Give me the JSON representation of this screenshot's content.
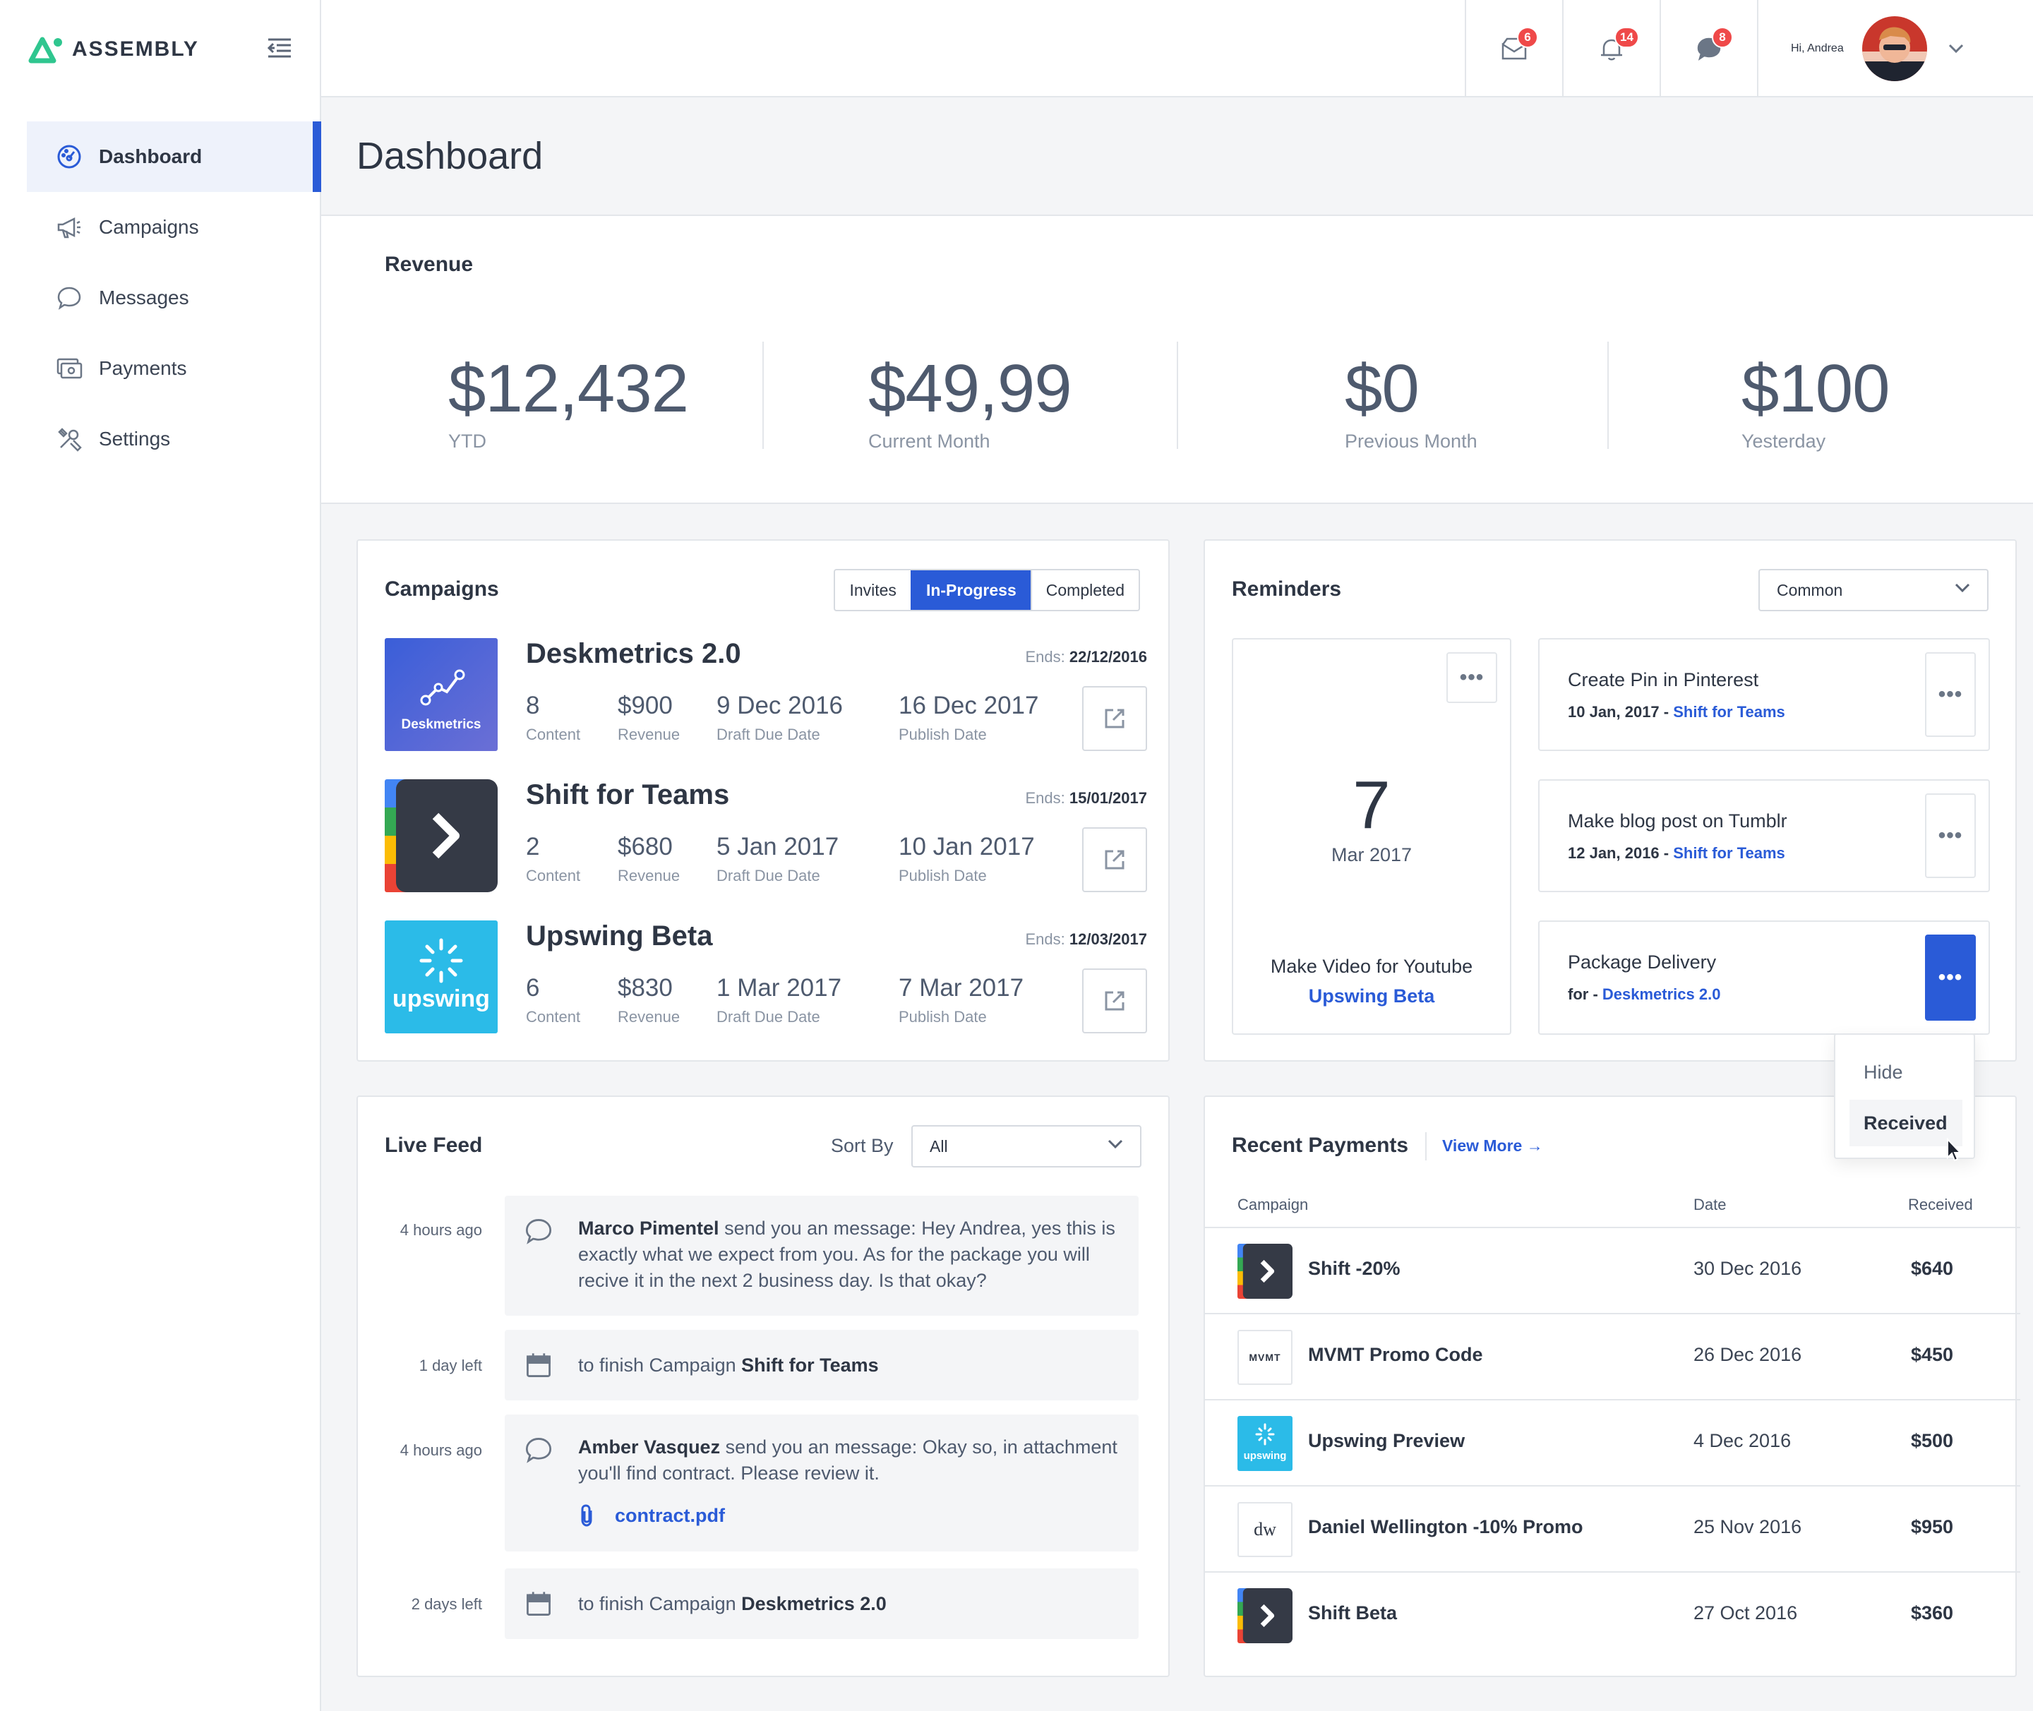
{
  "brand": {
    "name": "ASSEMBLY",
    "accent": "#2fc68f"
  },
  "colors": {
    "primary": "#2a5bd7",
    "badge": "#ef4949",
    "text": "#2e3644"
  },
  "sidebar": {
    "items": [
      {
        "label": "Dashboard",
        "icon": "dashboard-icon",
        "active": true
      },
      {
        "label": "Campaigns",
        "icon": "megaphone-icon"
      },
      {
        "label": "Messages",
        "icon": "chat-icon"
      },
      {
        "label": "Payments",
        "icon": "payments-icon"
      },
      {
        "label": "Settings",
        "icon": "settings-icon"
      }
    ]
  },
  "header": {
    "inbox_badge": "6",
    "notifications_badge": "14",
    "chat_badge": "8",
    "greeting": "Hi, Andrea"
  },
  "page": {
    "title": "Dashboard"
  },
  "revenue": {
    "title": "Revenue",
    "stats": [
      {
        "value": "$12,432",
        "label": "YTD"
      },
      {
        "value": "$49,99",
        "label": "Current Month"
      },
      {
        "value": "$0",
        "label": "Previous Month"
      },
      {
        "value": "$100",
        "label": "Yesterday"
      }
    ]
  },
  "campaigns": {
    "title": "Campaigns",
    "tabs": [
      "Invites",
      "In-Progress",
      "Completed"
    ],
    "active_tab": "In-Progress",
    "ends_label": "Ends:",
    "stat_labels": {
      "content": "Content",
      "revenue": "Revenue",
      "draft": "Draft Due Date",
      "publish": "Publish Date"
    },
    "items": [
      {
        "name": "Deskmetrics 2.0",
        "thumb_label": "Deskmetrics",
        "ends": "22/12/2016",
        "content": "8",
        "revenue": "$900",
        "draft": "9 Dec 2016",
        "publish": "16 Dec 2017"
      },
      {
        "name": "Shift for Teams",
        "ends": "15/01/2017",
        "content": "2",
        "revenue": "$680",
        "draft": "5 Jan 2017",
        "publish": "10 Jan 2017"
      },
      {
        "name": "Upswing Beta",
        "thumb_label": "upswing",
        "ends": "12/03/2017",
        "content": "6",
        "revenue": "$830",
        "draft": "1 Mar 2017",
        "publish": "7 Mar 2017"
      }
    ]
  },
  "reminders": {
    "title": "Reminders",
    "filter": "Common",
    "big": {
      "day": "7",
      "month": "Mar 2017",
      "task": "Make Video for Youtube",
      "campaign": "Upswing Beta"
    },
    "items": [
      {
        "title": "Create Pin in Pinterest",
        "date": "10 Jan, 2017 -",
        "campaign": "Shift for Teams"
      },
      {
        "title": "Make blog post on Tumblr",
        "date": "12 Jan, 2016 -",
        "campaign": "Shift for Teams"
      },
      {
        "title": "Package Delivery",
        "date": "for -",
        "campaign": "Deskmetrics 2.0"
      }
    ],
    "menu": {
      "hide": "Hide",
      "received": "Received"
    }
  },
  "live_feed": {
    "title": "Live Feed",
    "sort_label": "Sort By",
    "sort_value": "All",
    "items": [
      {
        "time": "4 hours ago",
        "who": "Marco Pimentel",
        "text": " send you an message: Hey Andrea, yes this is exactly what we expect from you. As for the package you will recive it in the next 2 business day. Is that okay?"
      },
      {
        "time": "1 day left",
        "text": "to finish Campaign ",
        "campaign": "Shift for Teams"
      },
      {
        "time": "4 hours ago",
        "who": "Amber Vasquez",
        "text": " send you an message: Okay so, in attachment you'll find contract. Please review it.",
        "attachment": "contract.pdf"
      },
      {
        "time": "2 days left",
        "text": "to finish Campaign ",
        "campaign": "Deskmetrics 2.0"
      }
    ]
  },
  "payments": {
    "title": "Recent Payments",
    "view_more": "View More →",
    "columns": [
      "Campaign",
      "Date",
      "Received"
    ],
    "rows": [
      {
        "name": "Shift -20%",
        "date": "30 Dec 2016",
        "amount": "$640",
        "thumb": "shift"
      },
      {
        "name": "MVMT Promo Code",
        "date": "26 Dec 2016",
        "amount": "$450",
        "thumb": "mvmt",
        "thumb_label": "MVMT"
      },
      {
        "name": "Upswing Preview",
        "date": "4 Dec 2016",
        "amount": "$500",
        "thumb": "upswing",
        "thumb_label": "upswing"
      },
      {
        "name": "Daniel Wellington -10% Promo",
        "date": "25 Nov 2016",
        "amount": "$950",
        "thumb": "dw",
        "thumb_label": "dw"
      },
      {
        "name": "Shift Beta",
        "date": "27 Oct 2016",
        "amount": "$360",
        "thumb": "shift"
      }
    ]
  }
}
